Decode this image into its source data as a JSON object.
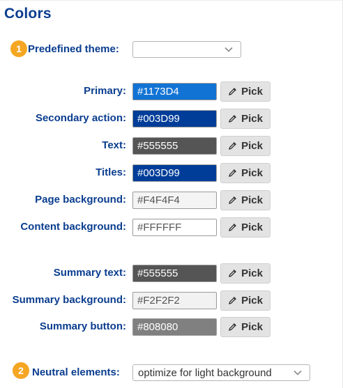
{
  "section_title": "Colors",
  "theme": {
    "step": "1",
    "label": "Predefined theme:",
    "value": ""
  },
  "pick_label": "Pick",
  "colors_group1": [
    {
      "label": "Primary:",
      "value": "#1173D4",
      "bg": "#1173D4",
      "fg": "#ffffff"
    },
    {
      "label": "Secondary action:",
      "value": "#003D99",
      "bg": "#003D99",
      "fg": "#ffffff"
    },
    {
      "label": "Text:",
      "value": "#555555",
      "bg": "#555555",
      "fg": "#ffffff"
    },
    {
      "label": "Titles:",
      "value": "#003D99",
      "bg": "#003D99",
      "fg": "#ffffff"
    },
    {
      "label": "Page background:",
      "value": "#F4F4F4",
      "bg": "#F4F4F4",
      "fg": "#555555"
    },
    {
      "label": "Content background:",
      "value": "#FFFFFF",
      "bg": "#FFFFFF",
      "fg": "#555555"
    }
  ],
  "colors_group2": [
    {
      "label": "Summary text:",
      "value": "#555555",
      "bg": "#555555",
      "fg": "#ffffff"
    },
    {
      "label": "Summary background:",
      "value": "#F2F2F2",
      "bg": "#F2F2F2",
      "fg": "#555555"
    },
    {
      "label": "Summary button:",
      "value": "#808080",
      "bg": "#808080",
      "fg": "#ffffff"
    }
  ],
  "neutral": {
    "step": "2",
    "label": "Neutral elements:",
    "value": "optimize for light background"
  }
}
